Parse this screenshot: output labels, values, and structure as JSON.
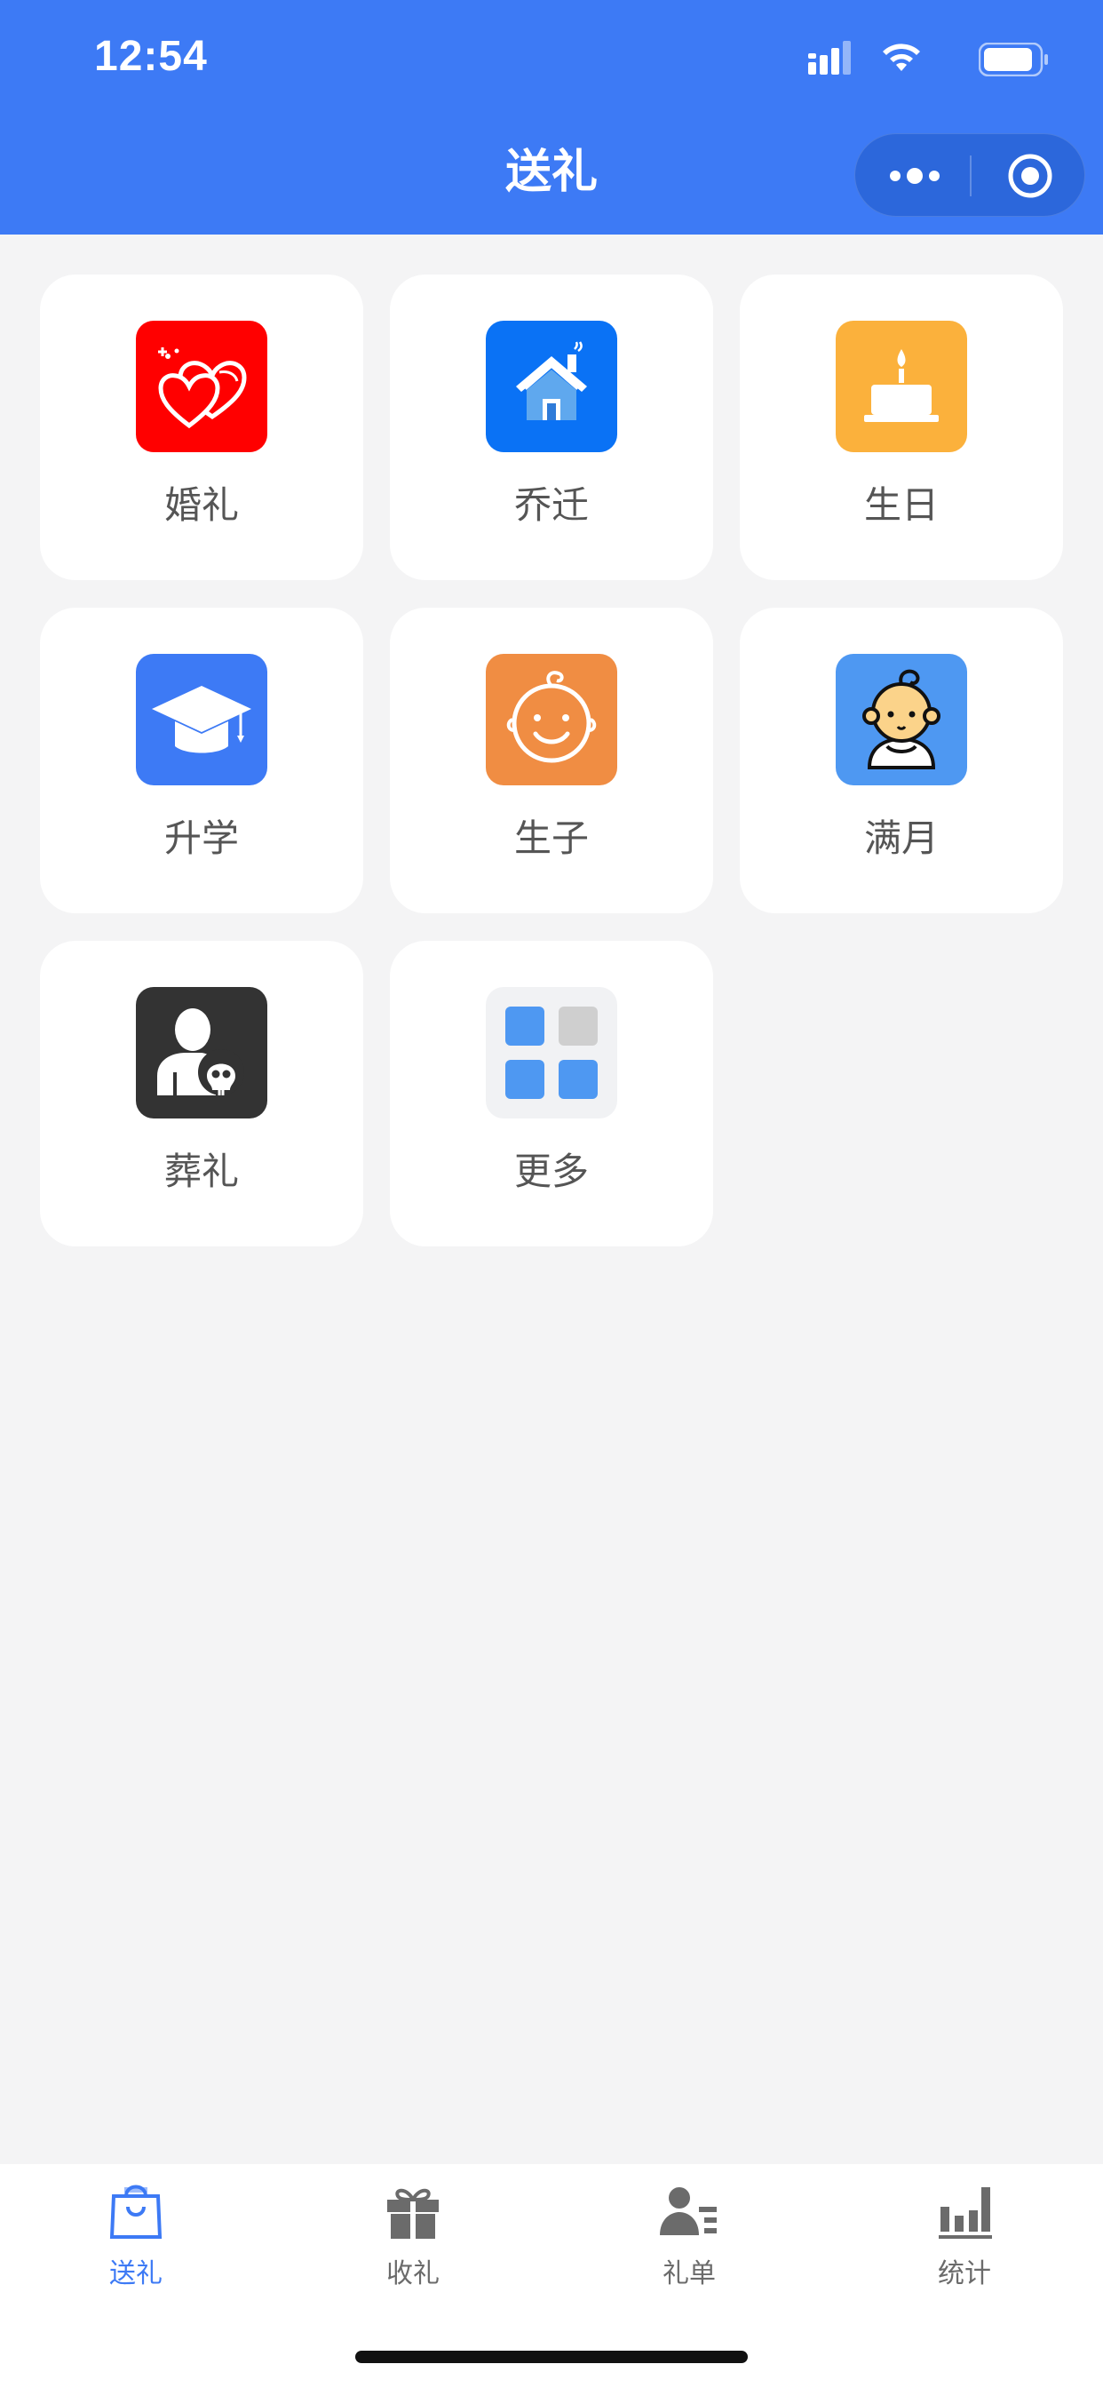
{
  "status_bar": {
    "time": "12:54"
  },
  "nav": {
    "title": "送礼"
  },
  "categories": [
    {
      "label": "婚礼",
      "icon": "hearts-icon",
      "color": "#ff0000"
    },
    {
      "label": "乔迁",
      "icon": "house-icon",
      "color": "#0a72f5"
    },
    {
      "label": "生日",
      "icon": "birthday-cake-icon",
      "color": "#fbb13c"
    },
    {
      "label": "升学",
      "icon": "graduation-cap-icon",
      "color": "#3d7af5"
    },
    {
      "label": "生子",
      "icon": "baby-face-icon",
      "color": "#f08d43"
    },
    {
      "label": "满月",
      "icon": "baby-icon",
      "color": "#4e98f2"
    },
    {
      "label": "葬礼",
      "icon": "mourner-skull-icon",
      "color": "#333333"
    },
    {
      "label": "更多",
      "icon": "more-grid-icon",
      "color": "#f1f2f4"
    }
  ],
  "tabbar": {
    "items": [
      {
        "label": "送礼",
        "icon": "gift-bag-icon",
        "active": true
      },
      {
        "label": "收礼",
        "icon": "gift-box-icon",
        "active": false
      },
      {
        "label": "礼单",
        "icon": "person-list-icon",
        "active": false
      },
      {
        "label": "统计",
        "icon": "bar-chart-icon",
        "active": false
      }
    ],
    "active_color": "#3d7af5",
    "inactive_color": "#6b6b6b"
  },
  "colors": {
    "accent": "#3d7af5",
    "background": "#f4f4f5"
  }
}
